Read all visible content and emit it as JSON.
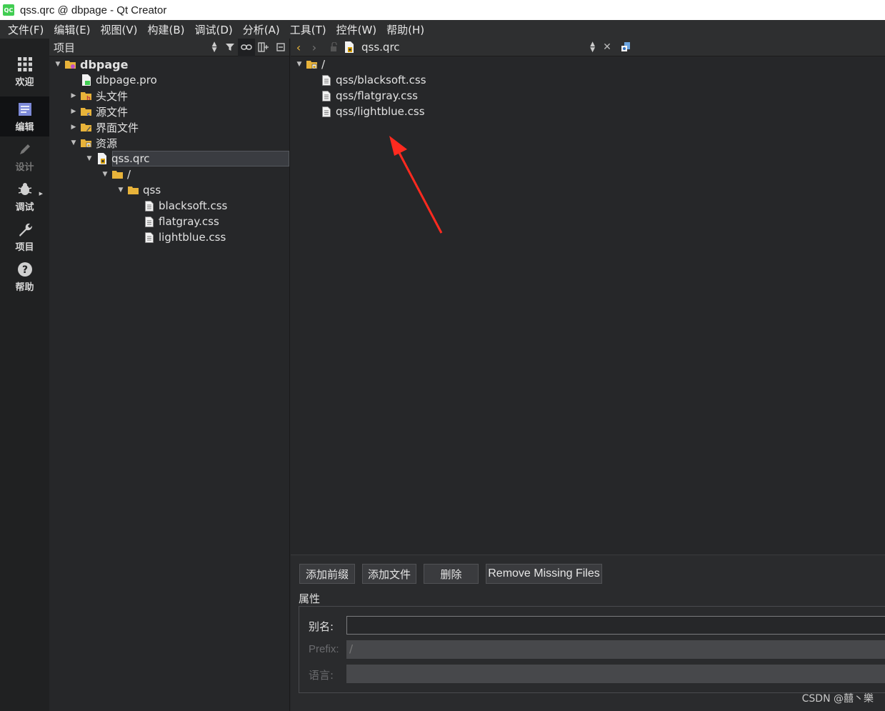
{
  "window": {
    "title": "qss.qrc @ dbpage - Qt Creator",
    "app_icon_text": "QC"
  },
  "menu": [
    "文件(F)",
    "编辑(E)",
    "视图(V)",
    "构建(B)",
    "调试(D)",
    "分析(A)",
    "工具(T)",
    "控件(W)",
    "帮助(H)"
  ],
  "modes": [
    {
      "label": "欢迎",
      "icon": "grid-icon",
      "active": false,
      "enabled": true
    },
    {
      "label": "编辑",
      "icon": "edit-document-icon",
      "active": true,
      "enabled": true
    },
    {
      "label": "设计",
      "icon": "pencil-icon",
      "active": false,
      "enabled": false
    },
    {
      "label": "调试",
      "icon": "bug-icon",
      "active": false,
      "enabled": true
    },
    {
      "label": "项目",
      "icon": "wrench-icon",
      "active": false,
      "enabled": true
    },
    {
      "label": "帮助",
      "icon": "help-icon",
      "active": false,
      "enabled": true
    }
  ],
  "project_panel": {
    "view_label": "项目",
    "tree": [
      {
        "label": "dbpage",
        "bold": true,
        "icon": "project-folder-icon",
        "expanded": true
      },
      {
        "label": "dbpage.pro",
        "icon": "pro-file-icon"
      },
      {
        "label": "头文件",
        "icon": "header-folder-icon",
        "expanded": false
      },
      {
        "label": "源文件",
        "icon": "source-folder-icon",
        "expanded": false
      },
      {
        "label": "界面文件",
        "icon": "form-folder-icon",
        "expanded": false
      },
      {
        "label": "资源",
        "icon": "resource-folder-icon",
        "expanded": true
      },
      {
        "label": "qss.qrc",
        "icon": "qrc-file-icon",
        "expanded": true,
        "selected": true
      },
      {
        "label": "/",
        "icon": "folder-icon",
        "expanded": true
      },
      {
        "label": "qss",
        "icon": "folder-icon",
        "expanded": true
      },
      {
        "label": "blacksoft.css",
        "icon": "file-icon"
      },
      {
        "label": "flatgray.css",
        "icon": "file-icon"
      },
      {
        "label": "lightblue.css",
        "icon": "file-icon"
      }
    ]
  },
  "editor": {
    "document": "qss.qrc",
    "resource_tree": [
      {
        "label": "/",
        "icon": "prefix-folder-icon",
        "expanded": true
      },
      {
        "label": "qss/blacksoft.css",
        "icon": "file-icon"
      },
      {
        "label": "qss/flatgray.css",
        "icon": "file-icon"
      },
      {
        "label": "qss/lightblue.css",
        "icon": "file-icon"
      }
    ],
    "buttons": {
      "add_prefix": "添加前缀",
      "add_files": "添加文件",
      "remove": "删除",
      "remove_missing": "Remove Missing Files"
    },
    "properties": {
      "title": "属性",
      "alias_label": "别名:",
      "alias_value": "",
      "prefix_label": "Prefix:",
      "prefix_value": "/",
      "language_label": "语言:",
      "language_value": ""
    }
  },
  "annotation": {
    "color": "#ff2a1f"
  },
  "watermark": "CSDN @囍丶樂",
  "colors": {
    "background": "#262729",
    "toolbar": "#2e2f30",
    "selection": "#3a3c41",
    "accent_folder": "#e8b33a"
  }
}
